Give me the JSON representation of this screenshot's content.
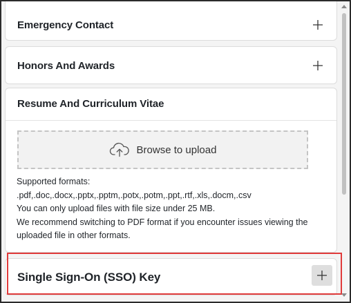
{
  "sections": {
    "emergency": {
      "title": "Emergency Contact"
    },
    "honors": {
      "title": "Honors And Awards"
    },
    "resume": {
      "title": "Resume And Curriculum Vitae",
      "upload_label": "Browse to upload",
      "help": {
        "formats_heading": "Supported formats:",
        "formats": ".pdf,.doc,.docx,.pptx,.pptm,.potx,.potm,.ppt,.rtf,.xls,.docm,.csv",
        "size_limit": "You can only upload files with file size under 25 MB.",
        "recommend": "We recommend switching to PDF format if you encounter issues viewing the uploaded file in other formats."
      }
    },
    "sso": {
      "title": "Single Sign-On (SSO) Key"
    }
  },
  "icons": {
    "expand": "plus-icon",
    "upload": "cloud-upload-icon",
    "scroll_up": "triangle-up-icon",
    "scroll_down": "triangle-down-icon"
  },
  "colors": {
    "highlight": "#e03a3a",
    "panel_bg": "#ffffff",
    "page_bg": "#f4f4f4"
  }
}
